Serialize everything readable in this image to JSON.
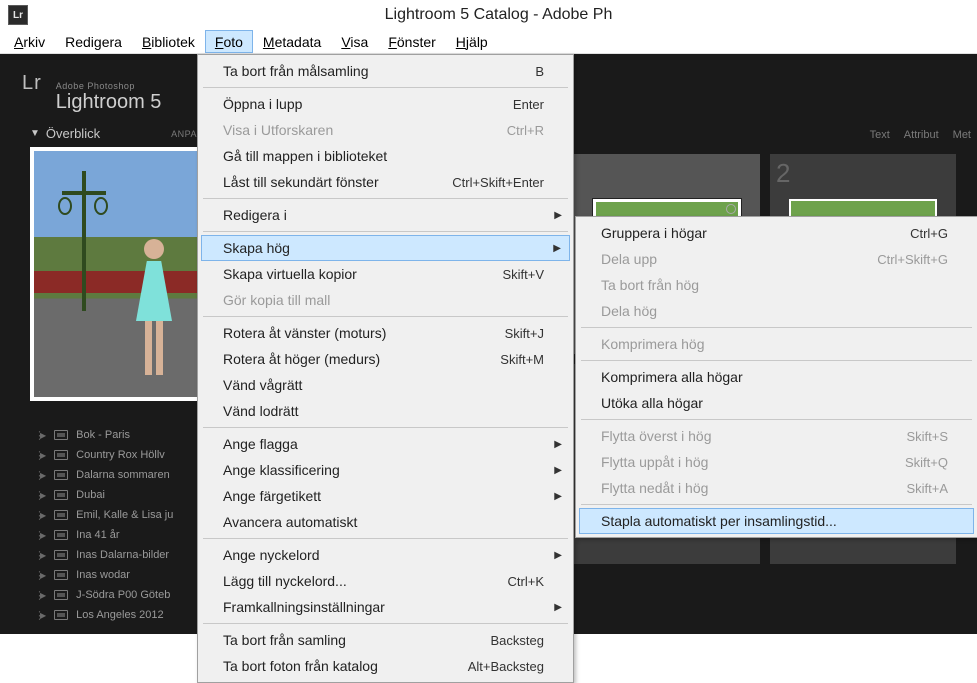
{
  "title": "Lightroom 5 Catalog - Adobe Ph",
  "app_icon_text": "Lr",
  "menubar": {
    "arkiv": "Arkiv",
    "redigera": "Redigera",
    "bibliotek": "Bibliotek",
    "foto": "Foto",
    "metadata": "Metadata",
    "visa": "Visa",
    "fonster": "Fönster",
    "hjalp": "Hjälp"
  },
  "brand": {
    "lr": "Lr",
    "small": "Adobe Photoshop",
    "big": "Lightroom 5"
  },
  "overblick": {
    "title": "Överblick",
    "anpass": "ANPASS"
  },
  "filter": {
    "text": "Text",
    "attribut": "Attribut",
    "met": "Met"
  },
  "collections": [
    "Bok - Paris",
    "Country Rox Höllv",
    "Dalarna sommaren",
    "Dubai",
    "Emil, Kalle & Lisa ju",
    "Ina 41 år",
    "Inas Dalarna-bilder",
    "Inas wodar",
    "J-Södra P00 Göteb",
    "Los Angeles 2012"
  ],
  "menu_foto": {
    "ta_bort_malsamling": {
      "label": "Ta bort från målsamling",
      "sc": "B"
    },
    "oppna_lupp": {
      "label": "Öppna i lupp",
      "sc": "Enter"
    },
    "visa_utforskaren": {
      "label": "Visa i Utforskaren",
      "sc": "Ctrl+R"
    },
    "ga_till_mappen": {
      "label": "Gå till mappen i biblioteket",
      "sc": ""
    },
    "last_sekundart": {
      "label": "Låst till sekundärt fönster",
      "sc": "Ctrl+Skift+Enter"
    },
    "redigera_i": {
      "label": "Redigera i",
      "sc": ""
    },
    "skapa_hog": {
      "label": "Skapa hög",
      "sc": ""
    },
    "skapa_virtuella": {
      "label": "Skapa virtuella kopior",
      "sc": "Skift+V"
    },
    "gor_kopia_mall": {
      "label": "Gör kopia till mall",
      "sc": ""
    },
    "rotera_vanster": {
      "label": "Rotera åt vänster (moturs)",
      "sc": "Skift+J"
    },
    "rotera_hoger": {
      "label": "Rotera åt höger (medurs)",
      "sc": "Skift+M"
    },
    "vand_vagratt": {
      "label": "Vänd vågrätt",
      "sc": ""
    },
    "vand_lodratt": {
      "label": "Vänd lodrätt",
      "sc": ""
    },
    "ange_flagga": {
      "label": "Ange flagga",
      "sc": ""
    },
    "ange_klass": {
      "label": "Ange klassificering",
      "sc": ""
    },
    "ange_farg": {
      "label": "Ange färgetikett",
      "sc": ""
    },
    "avancera_auto": {
      "label": "Avancera automatiskt",
      "sc": ""
    },
    "ange_nyckelord": {
      "label": "Ange nyckelord",
      "sc": ""
    },
    "lagg_till_nyckelord": {
      "label": "Lägg till nyckelord...",
      "sc": "Ctrl+K"
    },
    "framkallning": {
      "label": "Framkallningsinställningar",
      "sc": ""
    },
    "ta_bort_samling": {
      "label": "Ta bort från samling",
      "sc": "Backsteg"
    },
    "ta_bort_foton": {
      "label": "Ta bort foton från katalog",
      "sc": "Alt+Backsteg"
    }
  },
  "menu_skapa_hog": {
    "gruppera": {
      "label": "Gruppera i högar",
      "sc": "Ctrl+G"
    },
    "dela_upp": {
      "label": "Dela upp",
      "sc": "Ctrl+Skift+G"
    },
    "ta_bort_hog": {
      "label": "Ta bort från hög",
      "sc": ""
    },
    "dela_hog": {
      "label": "Dela hög",
      "sc": ""
    },
    "komprimera_hog": {
      "label": "Komprimera hög",
      "sc": ""
    },
    "komprimera_alla": {
      "label": "Komprimera alla högar",
      "sc": ""
    },
    "utoka_alla": {
      "label": "Utöka alla högar",
      "sc": ""
    },
    "flytta_overst": {
      "label": "Flytta överst i hög",
      "sc": "Skift+S"
    },
    "flytta_uppat": {
      "label": "Flytta uppåt i hög",
      "sc": "Skift+Q"
    },
    "flytta_nedat": {
      "label": "Flytta nedåt i hög",
      "sc": "Skift+A"
    },
    "stapla_auto": {
      "label": "Stapla automatiskt per insamlingstid...",
      "sc": ""
    }
  }
}
